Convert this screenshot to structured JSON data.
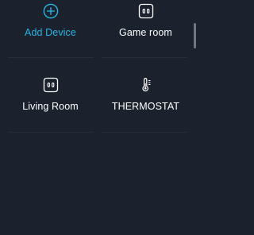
{
  "devices": [
    {
      "label": "Add Device",
      "icon": "plus-circle-icon",
      "accent": true
    },
    {
      "label": "Game room",
      "icon": "smart-plug-icon",
      "accent": false
    },
    {
      "label": "Living Room",
      "icon": "smart-plug-icon",
      "accent": false
    },
    {
      "label": "THERMOSTAT",
      "icon": "thermometer-icon",
      "accent": false
    }
  ],
  "colors": {
    "background": "#1b222e",
    "accent": "#2ab3e0",
    "text": "#ffffff",
    "divider": "#262e3b"
  }
}
